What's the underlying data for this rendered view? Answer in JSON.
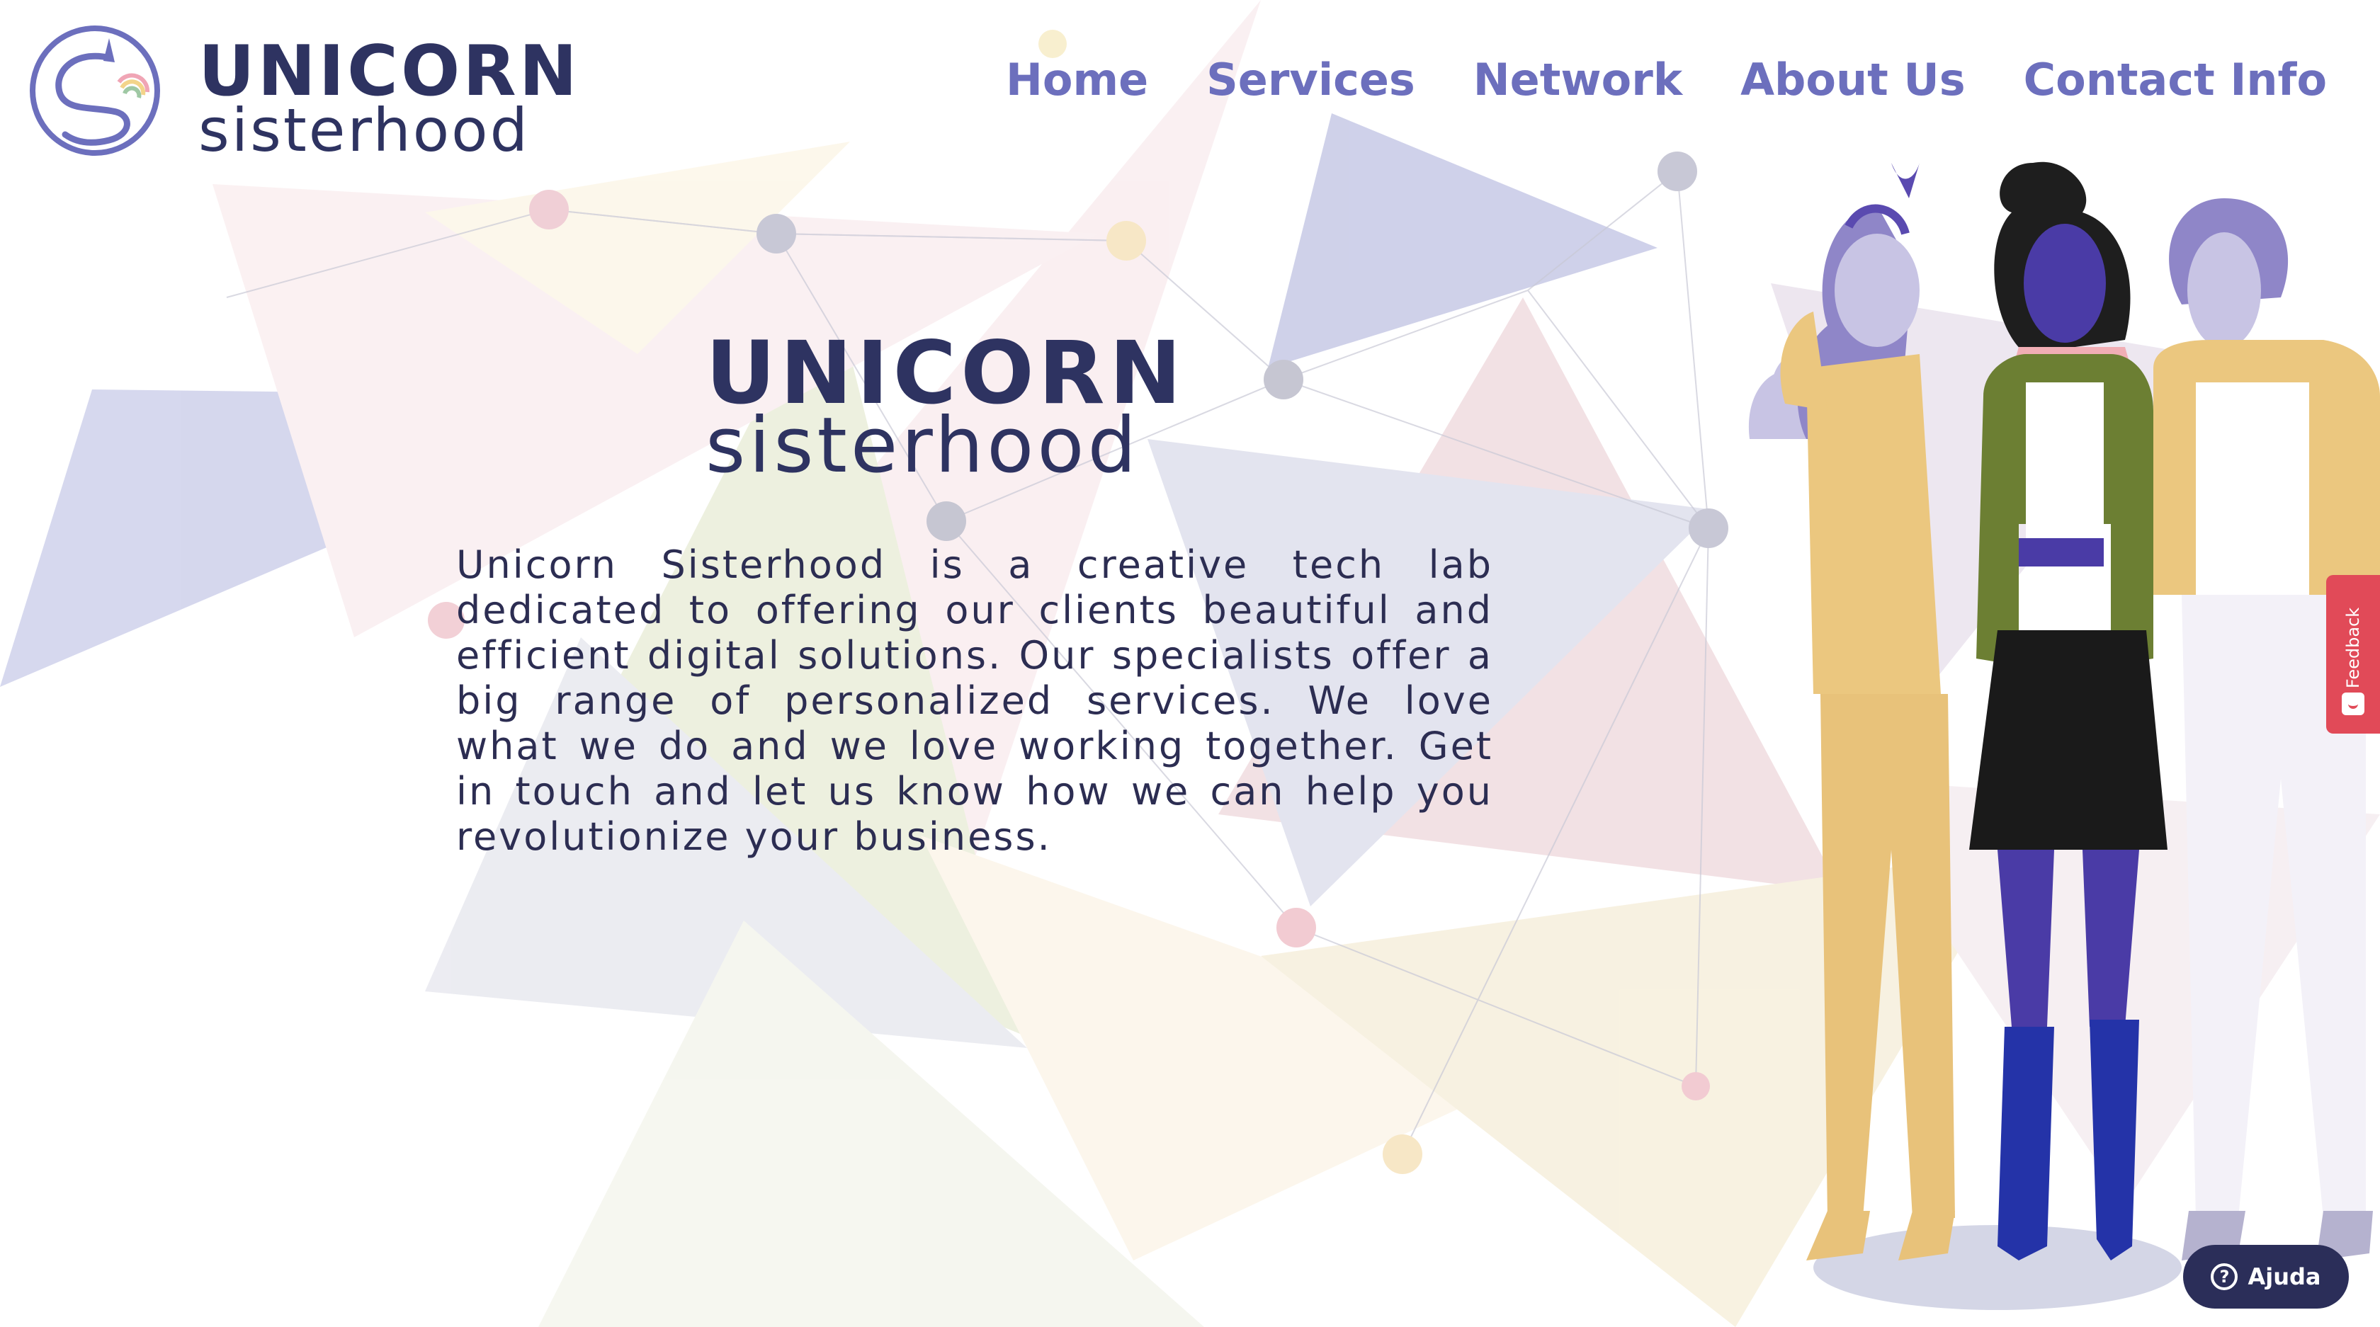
{
  "header": {
    "logo": {
      "line1": "UNICORN",
      "line2": "sisterhood"
    },
    "nav": [
      {
        "label": "Home"
      },
      {
        "label": "Services"
      },
      {
        "label": "Network"
      },
      {
        "label": "About Us"
      },
      {
        "label": "Contact Info"
      }
    ]
  },
  "hero": {
    "title_line1": "UNICORN",
    "title_line2": "sisterhood",
    "description": "Unicorn Sisterhood is a creative tech lab dedicated to offering our clients beautiful and efficient digital solutions. Our specialists offer a big range of personalized services. We love what we do and we love working together. Get in touch and let us know how we can help you revolutionize your business."
  },
  "widgets": {
    "feedback_label": "Feedback",
    "help_label": "Ajuda",
    "help_icon_glyph": "?"
  },
  "colors": {
    "brand_navy": "#2e3361",
    "nav_purple": "#6c6fbd",
    "feedback_red": "#e14a58",
    "help_bg": "#2b2e59"
  },
  "icons": [
    "unicorn-logo-icon",
    "feedback-smile-icon",
    "help-question-icon"
  ]
}
